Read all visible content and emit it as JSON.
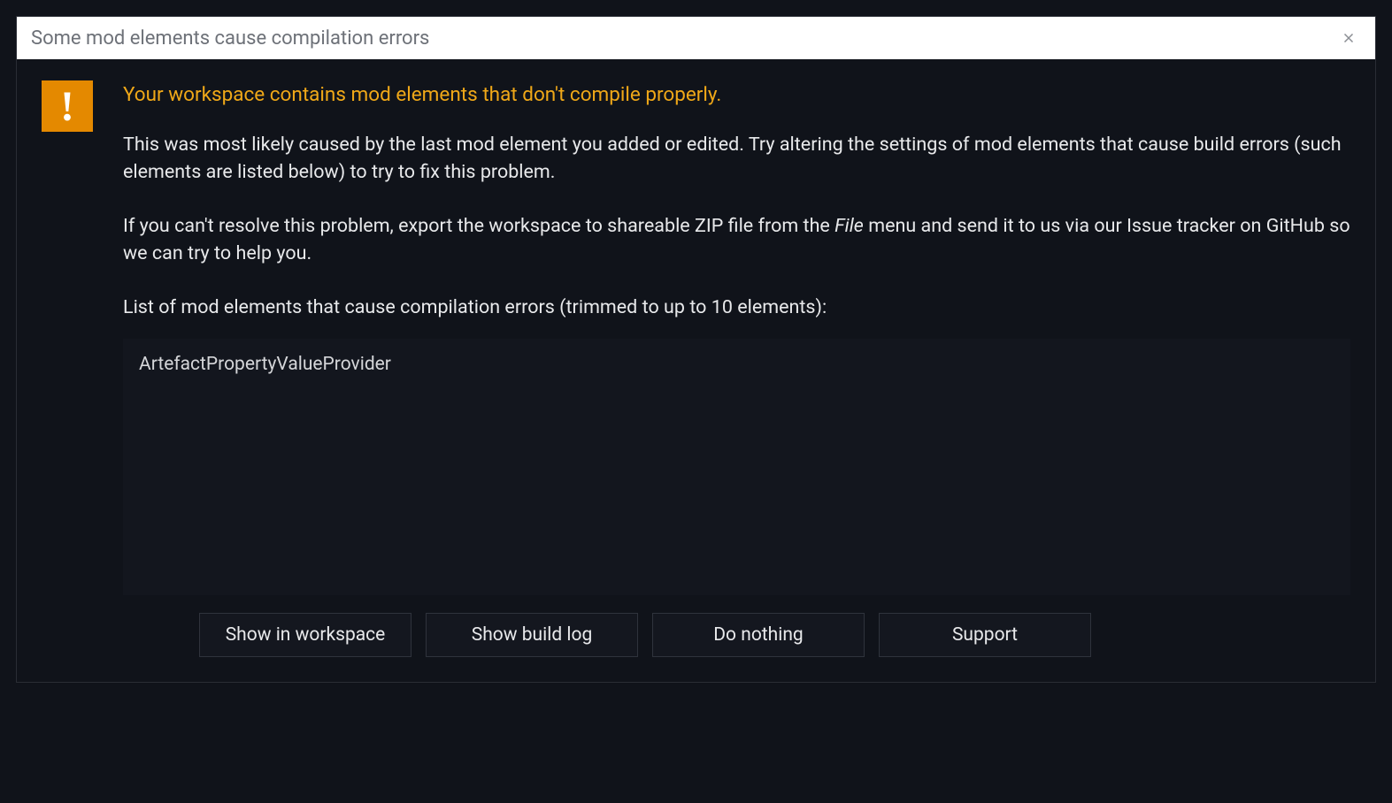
{
  "titlebar": {
    "title": "Some mod elements cause compilation errors"
  },
  "headline": "Your workspace contains mod elements that don't compile properly.",
  "paragraph1": "This was most likely caused by the last mod element you added or edited. Try altering the settings of mod elements that cause build errors (such elements are listed below) to try to fix this problem.",
  "paragraph2_part1": "If you can't resolve this problem, export the workspace to shareable ZIP file from the ",
  "paragraph2_em": "File",
  "paragraph2_part2": " menu and send it to us via our Issue tracker on GitHub so we can try to help you.",
  "list_label": "List of mod elements that cause compilation errors (trimmed to up to 10 elements):",
  "error_items": [
    "ArtefactPropertyValueProvider"
  ],
  "buttons": {
    "show_workspace": "Show in workspace",
    "show_log": "Show build log",
    "do_nothing": "Do nothing",
    "support": "Support"
  }
}
